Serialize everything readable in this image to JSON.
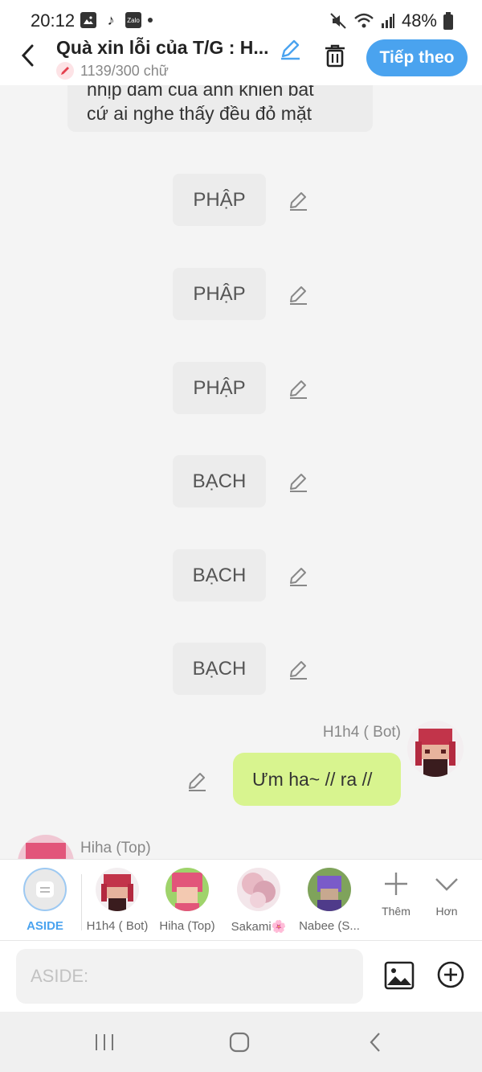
{
  "status_bar": {
    "time": "20:12",
    "battery": "48%",
    "app_icon_label": "Zalo"
  },
  "header": {
    "title": "Quà xin lỗi của T/G : H...",
    "word_count": "1139/300 chữ",
    "next_label": "Tiếp theo"
  },
  "chat": {
    "top_bubble_line1": "nhịp dâm của anh khiến bất",
    "top_bubble_line2": "cứ ai nghe thấy đều đỏ mặt",
    "narrations": [
      {
        "text": "PHẬP"
      },
      {
        "text": "PHẬP"
      },
      {
        "text": "PHẬP"
      },
      {
        "text": "BẠCH"
      },
      {
        "text": "BẠCH"
      },
      {
        "text": "BẠCH"
      }
    ],
    "bot_name": "H1h4 ( Bot)",
    "bot_message": "Ưm ha~ // ra //",
    "top_name": "Hiha (Top)"
  },
  "characters": [
    {
      "label": "ASIDE"
    },
    {
      "label": "H1h4 ( Bot)"
    },
    {
      "label": "Hiha (Top)"
    },
    {
      "label": "Sakami🌸"
    },
    {
      "label": "Nabee (S..."
    }
  ],
  "tools": {
    "more_label": "Thêm",
    "less_label": "Hơn"
  },
  "input": {
    "placeholder": "ASIDE:"
  },
  "colors": {
    "accent": "#4aa3ef",
    "bubble_green": "#d8f48f",
    "bubble_gray": "#ececec"
  }
}
